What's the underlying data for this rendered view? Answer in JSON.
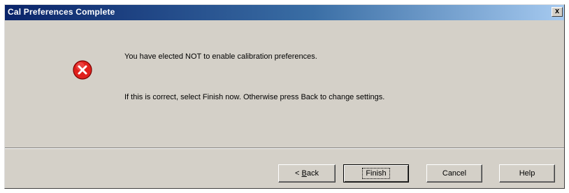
{
  "window": {
    "title": "Cal Preferences Complete",
    "close_glyph": "x"
  },
  "icon": "error-icon",
  "message": {
    "line1": "You have elected NOT to enable calibration preferences.",
    "line2": "If this is correct, select Finish now.  Otherwise press Back to change settings."
  },
  "buttons": {
    "back_prefix": "< ",
    "back_mnemonic": "B",
    "back_rest": "ack",
    "finish": "Finish",
    "cancel": "Cancel",
    "help": "Help"
  },
  "colors": {
    "title_bar": "#0a246a",
    "dialog_bg": "#d4d0c8",
    "error_red": "#e0201c"
  }
}
